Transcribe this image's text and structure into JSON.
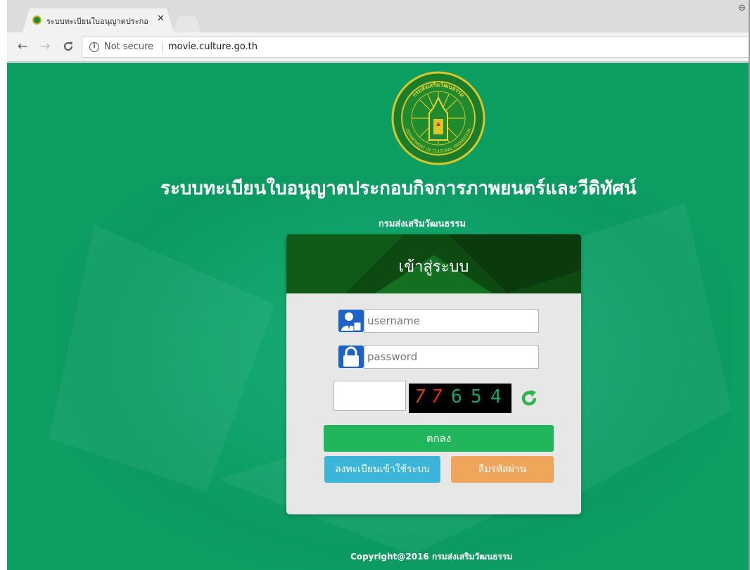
{
  "browser": {
    "tab_title": "ระบบทะเบียนใบอนุญาตประกอ",
    "tab_close": "✕",
    "nav": {
      "back": "←",
      "forward": "→",
      "reload": "C"
    },
    "info_glyph": "i",
    "security_label": "Not secure",
    "url": "movie.culture.go.th",
    "window_glyph": "⊖"
  },
  "page": {
    "title": "ระบบทะเบียนใบอนุญาตประกอบกิจการภาพยนตร์และวีดิทัศน์",
    "subtitle": "กรมส่งเสริมวัฒนธรรม",
    "seal_text_top": "กรมส่งเสริมวัฒนธรรม",
    "seal_text_bottom": "DEPARTMENT OF CULTURAL PROMOTION",
    "login": {
      "heading": "เข้าสู่ระบบ",
      "username_placeholder": "username",
      "password_placeholder": "password",
      "captcha_digits": [
        "7",
        "7",
        "6",
        "5",
        "4"
      ],
      "submit_label": "ตกลง",
      "register_label": "ลงทะเบียนเข้าใช้ระบบ",
      "forgot_label": "ลืมรหัสผ่าน"
    },
    "footer": "Copyright@2016 กรมส่งเสริมวัฒนธรรม"
  },
  "colors": {
    "page_bg": "#0d9f62",
    "card_header": "#0d4a12",
    "submit": "#22b65c",
    "register": "#3bb5d9",
    "forgot": "#f0a65a",
    "icon_blue": "#1c62c9"
  },
  "icons": {
    "username": "user-icon",
    "password": "lock-icon",
    "refresh": "refresh-icon",
    "seal": "department-seal-logo"
  }
}
